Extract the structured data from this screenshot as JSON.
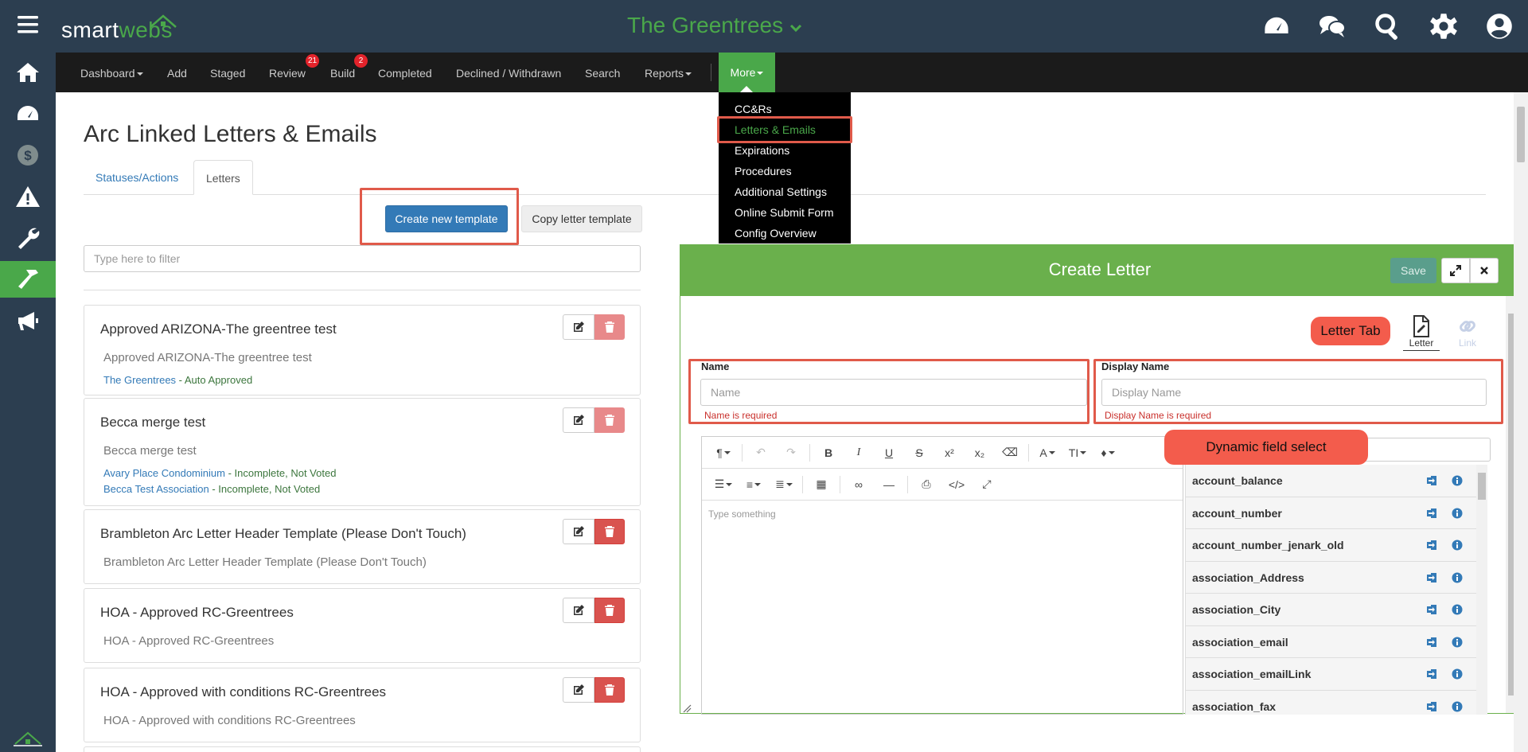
{
  "app": {
    "logo_text_a": "smart",
    "logo_text_b": "webs",
    "site_title": "The Greentrees",
    "brand_color": "#4aa84a",
    "header_color": "#2c3e50"
  },
  "sidebar": {
    "icons": [
      "menu-icon",
      "home-icon",
      "dashboard-gauge-icon",
      "dollar-icon",
      "warning-icon",
      "wrench-icon",
      "hammer-icon",
      "megaphone-icon",
      "house-logo-icon"
    ]
  },
  "top_icons": [
    "dashboard-gauge-icon",
    "chat-icon",
    "search-icon",
    "gear-icon",
    "user-icon"
  ],
  "nav": {
    "items": [
      {
        "label": "Dashboard",
        "badge": ""
      },
      {
        "label": "Add",
        "badge": ""
      },
      {
        "label": "Staged",
        "badge": ""
      },
      {
        "label": "Review",
        "badge": "21"
      },
      {
        "label": "Build",
        "badge": "2"
      },
      {
        "label": "Completed",
        "badge": ""
      },
      {
        "label": "Declined / Withdrawn",
        "badge": ""
      },
      {
        "label": "Search",
        "badge": ""
      },
      {
        "label": "Reports",
        "badge": ""
      }
    ],
    "more_label": "More"
  },
  "more_menu": {
    "items": [
      "CC&Rs",
      "Letters & Emails",
      "Expirations",
      "Procedures",
      "Additional Settings",
      "Online Submit Form",
      "Config Overview"
    ],
    "active": "Letters & Emails"
  },
  "page": {
    "title": "Arc Linked Letters & Emails",
    "tabs": [
      "Statuses/Actions",
      "Letters"
    ],
    "active_tab": "Letters",
    "create_button": "Create new template",
    "copy_button": "Copy letter template",
    "filter_placeholder": "Type here to filter"
  },
  "templates": [
    {
      "title": "Approved ARIZONA-The greentree test",
      "subtitle": "Approved ARIZONA-The greentree test",
      "links": [
        {
          "assoc": "The Greentrees",
          "sep": " - ",
          "status": "Auto Approved"
        }
      ]
    },
    {
      "title": "Becca merge test",
      "subtitle": "Becca merge test",
      "links": [
        {
          "assoc": "Avary Place Condominium",
          "sep": " - ",
          "status": "Incomplete, Not Voted"
        },
        {
          "assoc": "Becca Test Association",
          "sep": " - ",
          "status": "Incomplete, Not Voted"
        }
      ]
    },
    {
      "title": "Brambleton Arc Letter Header Template (Please Don't Touch)",
      "subtitle": "Brambleton Arc Letter Header Template (Please Don't Touch)",
      "links": []
    },
    {
      "title": "HOA - Approved RC-Greentrees",
      "subtitle": "HOA - Approved RC-Greentrees",
      "links": []
    },
    {
      "title": "HOA - Approved with conditions RC-Greentrees",
      "subtitle": "HOA - Approved with conditions RC-Greentrees",
      "links": []
    }
  ],
  "panel": {
    "title": "Create Letter",
    "save_label": "Save",
    "letter_tab_callout": "Letter Tab",
    "letter_tab_label": "Letter",
    "link_tab_label": "Link",
    "name_label": "Name",
    "name_placeholder": "Name",
    "name_error": "Name is required",
    "display_name_label": "Display Name",
    "display_name_placeholder": "Display Name",
    "display_name_error": "Display Name is required",
    "dynamic_field_callout": "Dynamic field select",
    "editor_placeholder": "Type something",
    "dynamic_fields": [
      "account_balance",
      "account_number",
      "account_number_jenark_old",
      "association_Address",
      "association_City",
      "association_email",
      "association_emailLink",
      "association_fax"
    ]
  }
}
